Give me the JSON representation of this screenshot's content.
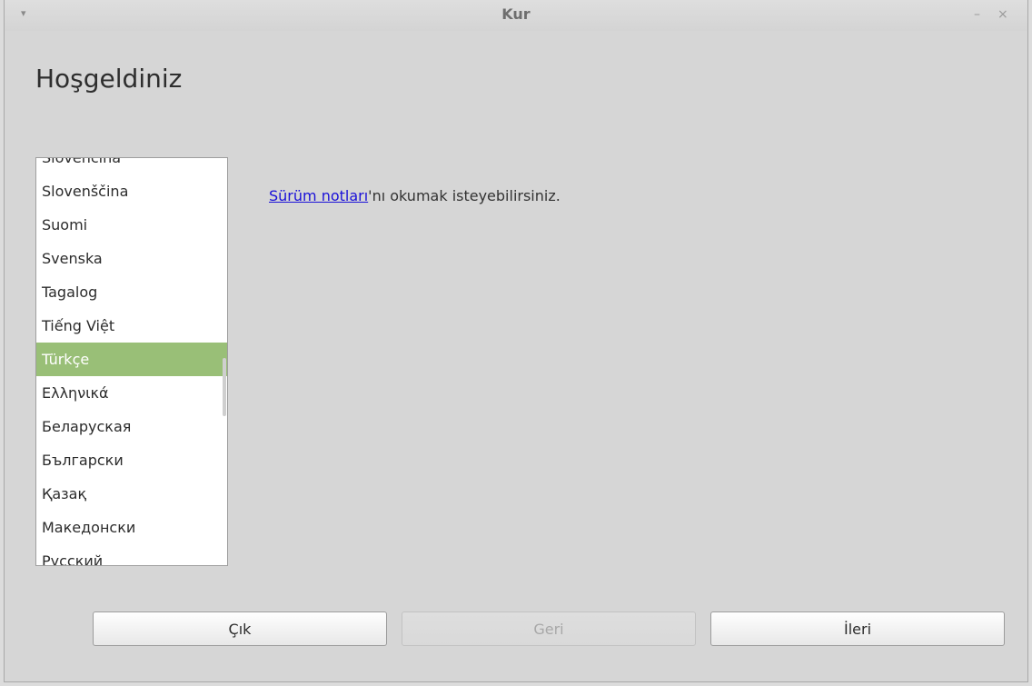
{
  "window": {
    "title": "Kur",
    "menu_arrow": "▾",
    "minimize": "–",
    "close": "×"
  },
  "page": {
    "heading": "Hoşgeldiniz"
  },
  "languages": {
    "items": [
      "Slovenčina",
      "Slovenščina",
      "Suomi",
      "Svenska",
      "Tagalog",
      "Tiếng Việt",
      "Türkçe",
      "Ελληνικά",
      "Беларуская",
      "Български",
      "Қазақ",
      "Македонски",
      "Русский"
    ],
    "selected": "Türkçe"
  },
  "release": {
    "link": "Sürüm notları",
    "suffix": "'nı okumak isteyebilirsiniz."
  },
  "buttons": {
    "quit": "Çık",
    "back": "Geri",
    "next": "İleri"
  },
  "colors": {
    "selection": "#99bf77",
    "link": "#1a10d8"
  }
}
